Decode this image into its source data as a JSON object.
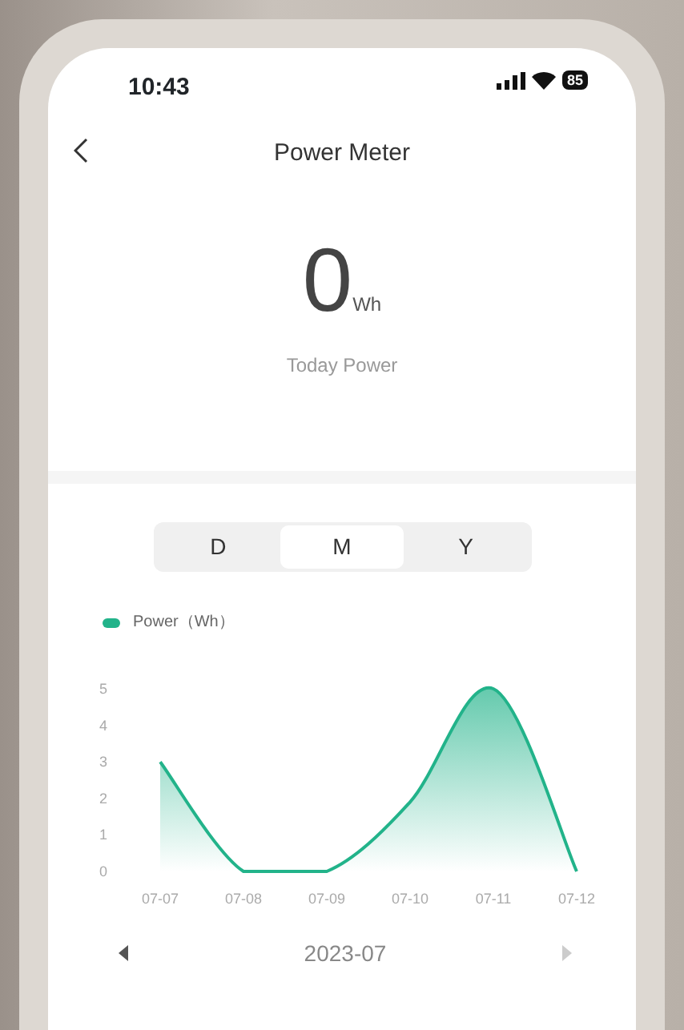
{
  "status_bar": {
    "time": "10:43",
    "battery": "85"
  },
  "header": {
    "title": "Power Meter"
  },
  "summary": {
    "value": "0",
    "unit": "Wh",
    "label": "Today Power"
  },
  "tabs": [
    {
      "label": "D",
      "selected": false
    },
    {
      "label": "M",
      "selected": true
    },
    {
      "label": "Y",
      "selected": false
    }
  ],
  "chart": {
    "chart_data": {
      "type": "area",
      "categories": [
        "07-07",
        "07-08",
        "07-09",
        "07-10",
        "07-11",
        "07-12"
      ],
      "series": [
        {
          "name": "Power（Wh）",
          "color": "#22b38a",
          "values": [
            3,
            0,
            0,
            1.9,
            5,
            0
          ]
        }
      ],
      "ylim": [
        0,
        5
      ],
      "yticks": [
        0,
        1,
        2,
        3,
        4,
        5
      ]
    }
  },
  "period": {
    "label": "2023-07",
    "prev_disabled": false,
    "next_disabled": true
  }
}
